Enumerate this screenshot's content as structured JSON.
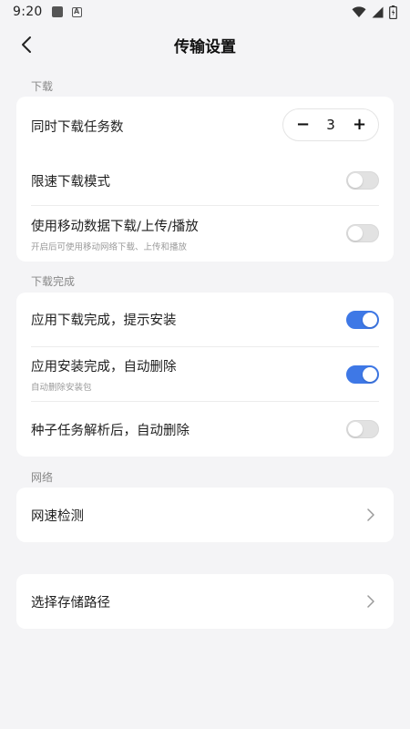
{
  "status_bar": {
    "time": "9:20",
    "icons": [
      "notification-square-icon",
      "notification-a-icon",
      "wifi-icon",
      "signal-icon",
      "battery-icon"
    ]
  },
  "header": {
    "title": "传输设置",
    "back_icon": "back-arrow-icon"
  },
  "sections": {
    "download": {
      "label": "下载",
      "concurrent_tasks": {
        "label": "同时下载任务数",
        "value": "3",
        "minus": "−",
        "plus": "+"
      },
      "speed_limit": {
        "label": "限速下载模式",
        "enabled": false
      },
      "mobile_data": {
        "label": "使用移动数据下载/上传/播放",
        "sub": "开启后可使用移动网络下载、上传和播放",
        "enabled": false
      }
    },
    "download_complete": {
      "label": "下载完成",
      "prompt_install": {
        "label": "应用下载完成，提示安装",
        "enabled": true
      },
      "auto_delete": {
        "label": "应用安装完成，自动删除",
        "sub": "自动删除安装包",
        "enabled": true
      },
      "torrent_delete": {
        "label": "种子任务解析后，自动删除",
        "enabled": false
      }
    },
    "network": {
      "label": "网络",
      "speed_test": {
        "label": "网速检测"
      }
    },
    "storage": {
      "path": {
        "label": "选择存储路径"
      }
    }
  },
  "colors": {
    "accent": "#3e78e6",
    "background": "#f4f4f6",
    "card": "#ffffff",
    "toggle_off": "#e2e2e2"
  }
}
